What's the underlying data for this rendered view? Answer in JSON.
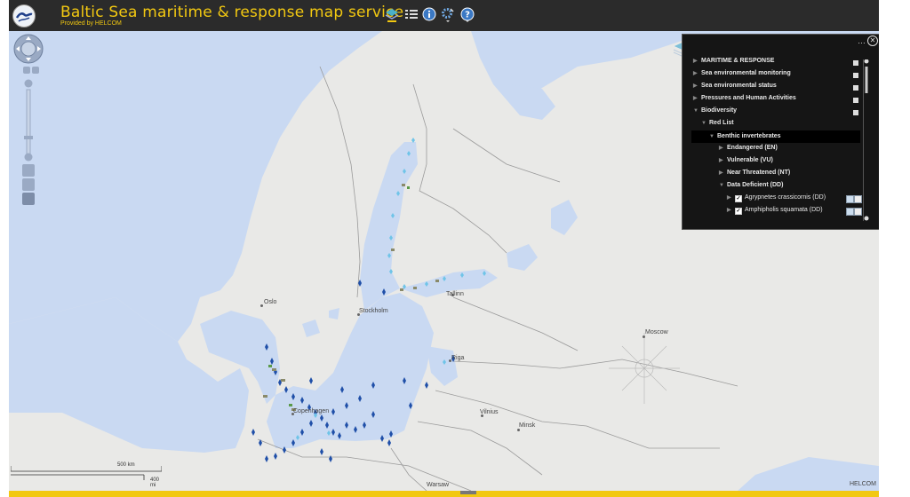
{
  "header": {
    "title": "Baltic Sea maritime & response map service",
    "subtitle": "Provided by HELCOM",
    "tools": [
      "layers-tool",
      "legend-tool",
      "info-tool",
      "settings-tool",
      "help-tool"
    ]
  },
  "map": {
    "cities": [
      "Oslo",
      "Stockholm",
      "Tallinn",
      "Riga",
      "Moscow",
      "Copenhagen",
      "Vilnius",
      "Minsk",
      "Warsaw"
    ],
    "scale": {
      "km_label": "500 km",
      "mi_label": "400 mi"
    },
    "attribution": "HELCOM",
    "colors": {
      "sea": "#c9d9f2",
      "land": "#e9e9e7",
      "border": "#9a9a9a"
    }
  },
  "layer_panel": {
    "items": [
      {
        "label": "MARITIME & RESPONSE"
      },
      {
        "label": "Sea environmental monitoring"
      },
      {
        "label": "Sea environmental status"
      },
      {
        "label": "Pressures and Human Activities"
      },
      {
        "label": "Biodiversity"
      },
      {
        "label": "Red List"
      },
      {
        "label": "Benthic invertebrates"
      },
      {
        "label": "Endangered (EN)"
      },
      {
        "label": "Vulnerable (VU)"
      },
      {
        "label": "Near Threatened (NT)"
      },
      {
        "label": "Data Deficient (DD)"
      },
      {
        "label": "Agrypnetes crassicornis (DD)"
      },
      {
        "label": "Amphipholis squamata (DD)"
      }
    ]
  },
  "colors": {
    "header_bg": "#2b2b2b",
    "accent": "#f2c811",
    "panel_bg": "#151515"
  }
}
